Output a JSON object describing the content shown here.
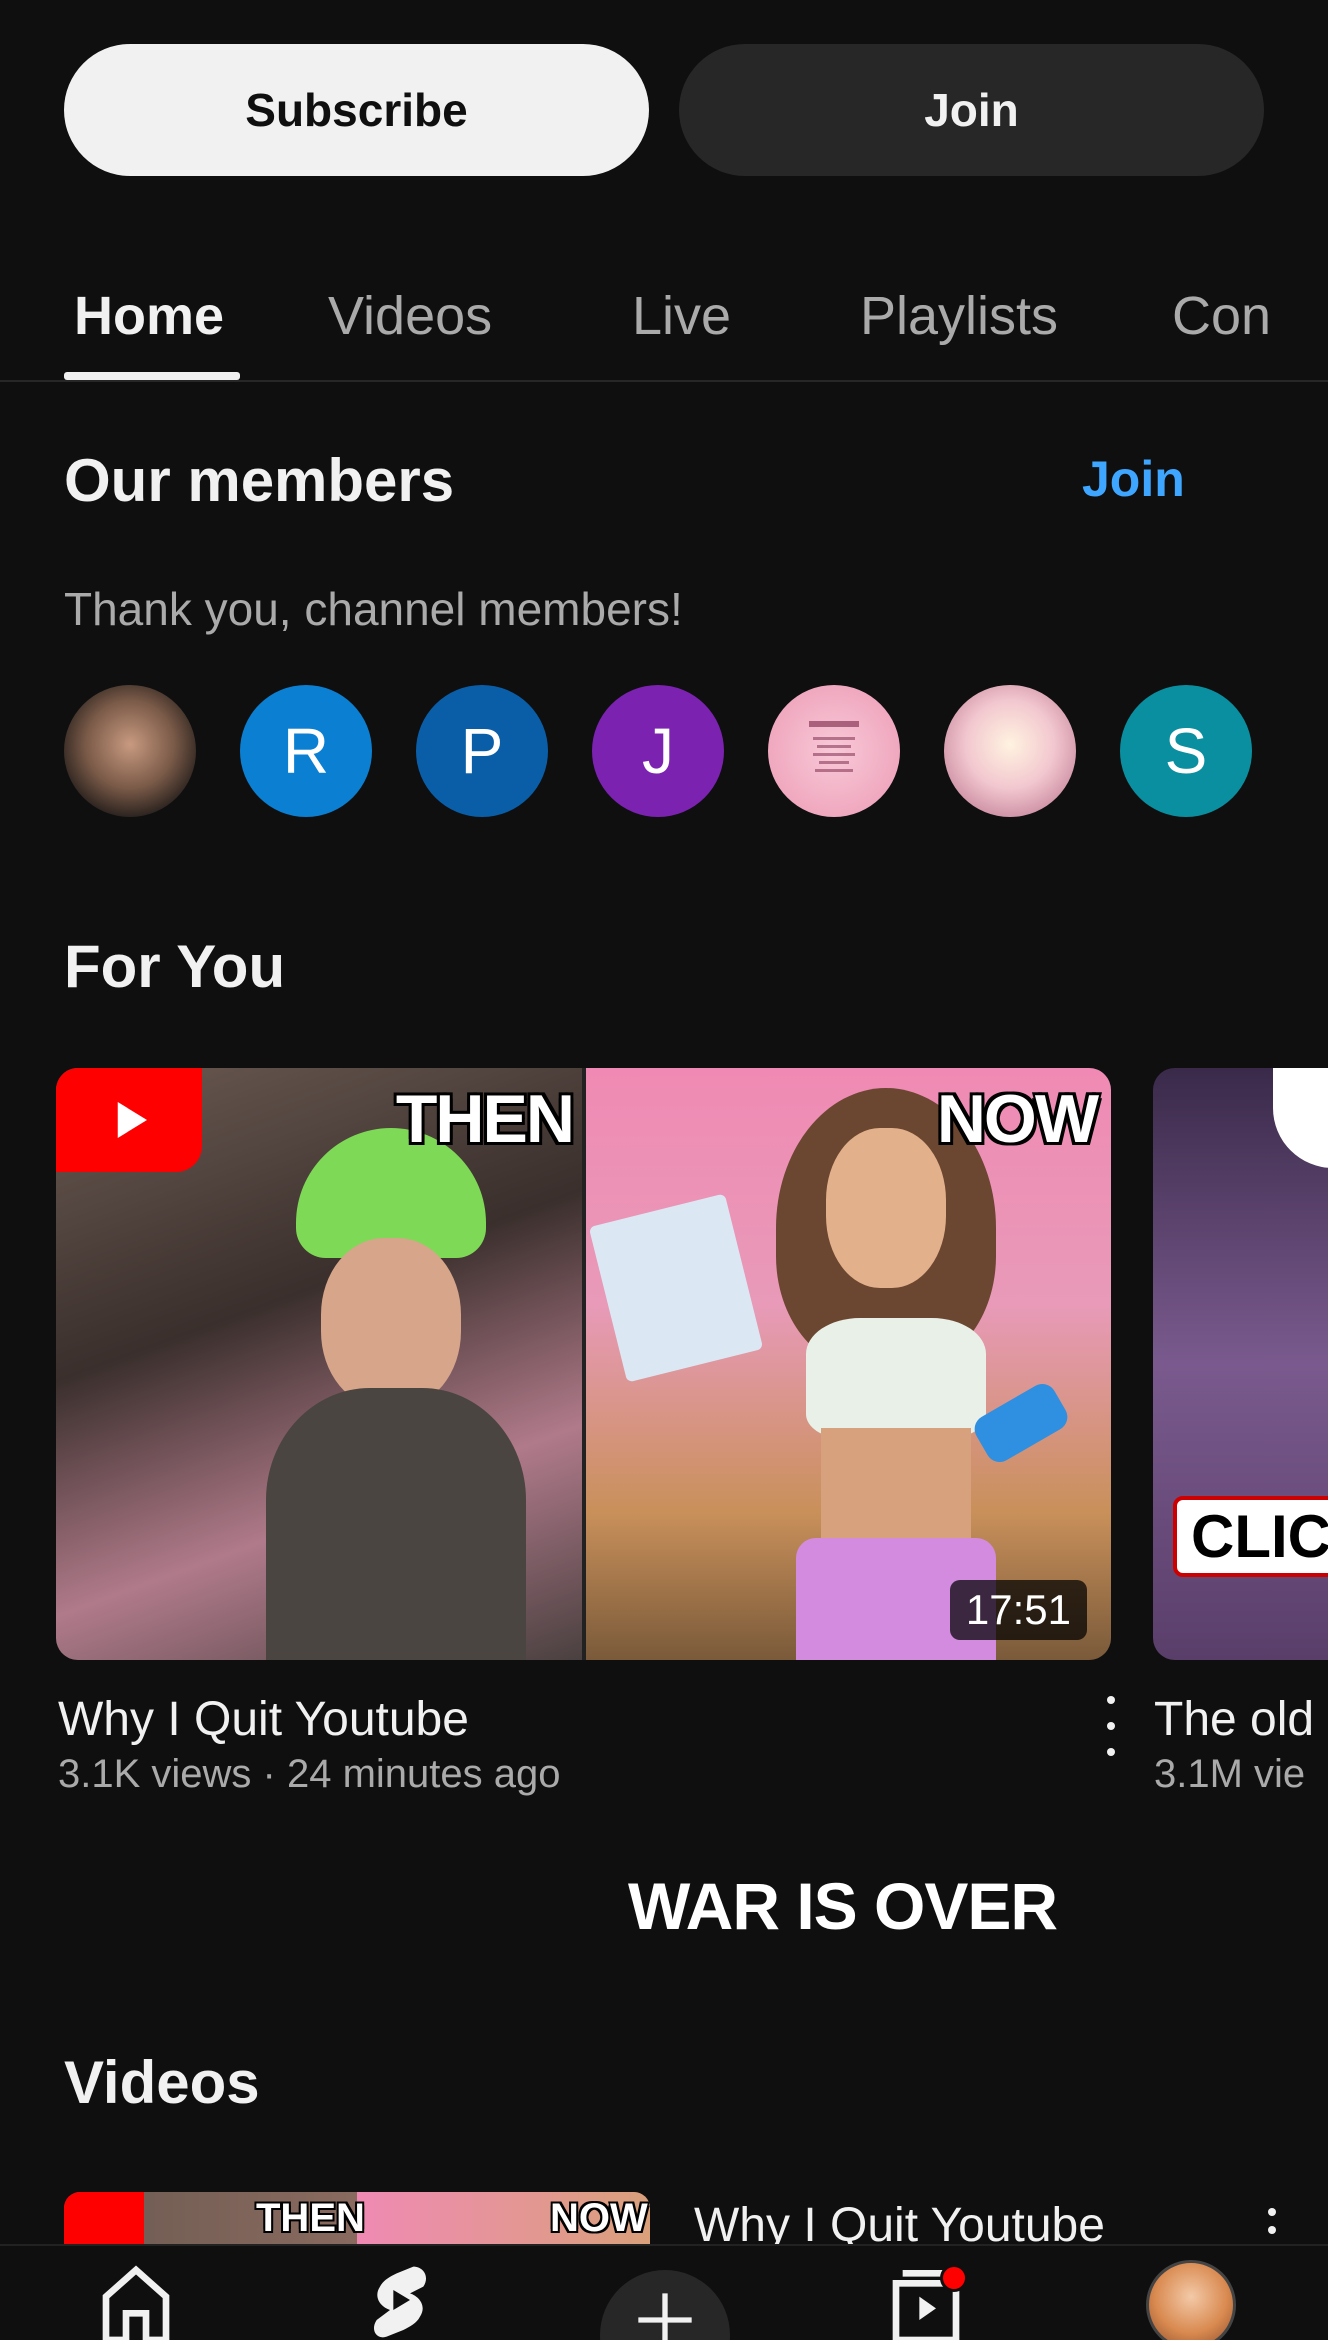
{
  "channel_actions": {
    "subscribe_label": "Subscribe",
    "join_label": "Join"
  },
  "tabs": [
    {
      "label": "Home",
      "active": true
    },
    {
      "label": "Videos",
      "active": false
    },
    {
      "label": "Live",
      "active": false
    },
    {
      "label": "Playlists",
      "active": false
    },
    {
      "label": "Con",
      "active": false
    }
  ],
  "members": {
    "title": "Our members",
    "join_link": "Join",
    "subtitle": "Thank you, channel members!",
    "avatars": [
      {
        "type": "photo",
        "letter": "",
        "color": "#8a7a6a"
      },
      {
        "type": "letter",
        "letter": "R",
        "color": "#0b7fd1"
      },
      {
        "type": "letter",
        "letter": "P",
        "color": "#0a5ea8"
      },
      {
        "type": "letter",
        "letter": "J",
        "color": "#7b22b0"
      },
      {
        "type": "photo",
        "letter": "",
        "color": "#f3b3c8"
      },
      {
        "type": "photo",
        "letter": "",
        "color": "#e7c0c8"
      },
      {
        "type": "letter",
        "letter": "S",
        "color": "#0a8fa0"
      }
    ]
  },
  "for_you": {
    "title": "For You",
    "videos": [
      {
        "title": "Why I Quit Youtube",
        "meta": "3.1K views · 24 minutes ago",
        "duration": "17:51",
        "thumb_left_label": "THEN",
        "thumb_right_label": "NOW"
      },
      {
        "title": "The old",
        "meta": "3.1M vie",
        "thumb_label": "CLIC"
      }
    ]
  },
  "caption_overlay": "WAR IS OVER",
  "videos_section": {
    "title": "Videos",
    "first_item": {
      "title": "Why I Quit Youtube",
      "thumb_left_label": "THEN",
      "thumb_right_label": "NOW"
    }
  },
  "bottom_nav": {
    "items": [
      "home-icon",
      "shorts-icon",
      "create-icon",
      "subscriptions-icon",
      "profile-avatar"
    ],
    "subscriptions_has_notification": true
  },
  "colors": {
    "background": "#0f0f0f",
    "accent_link": "#3ea6ff",
    "notification": "#ff0000"
  }
}
